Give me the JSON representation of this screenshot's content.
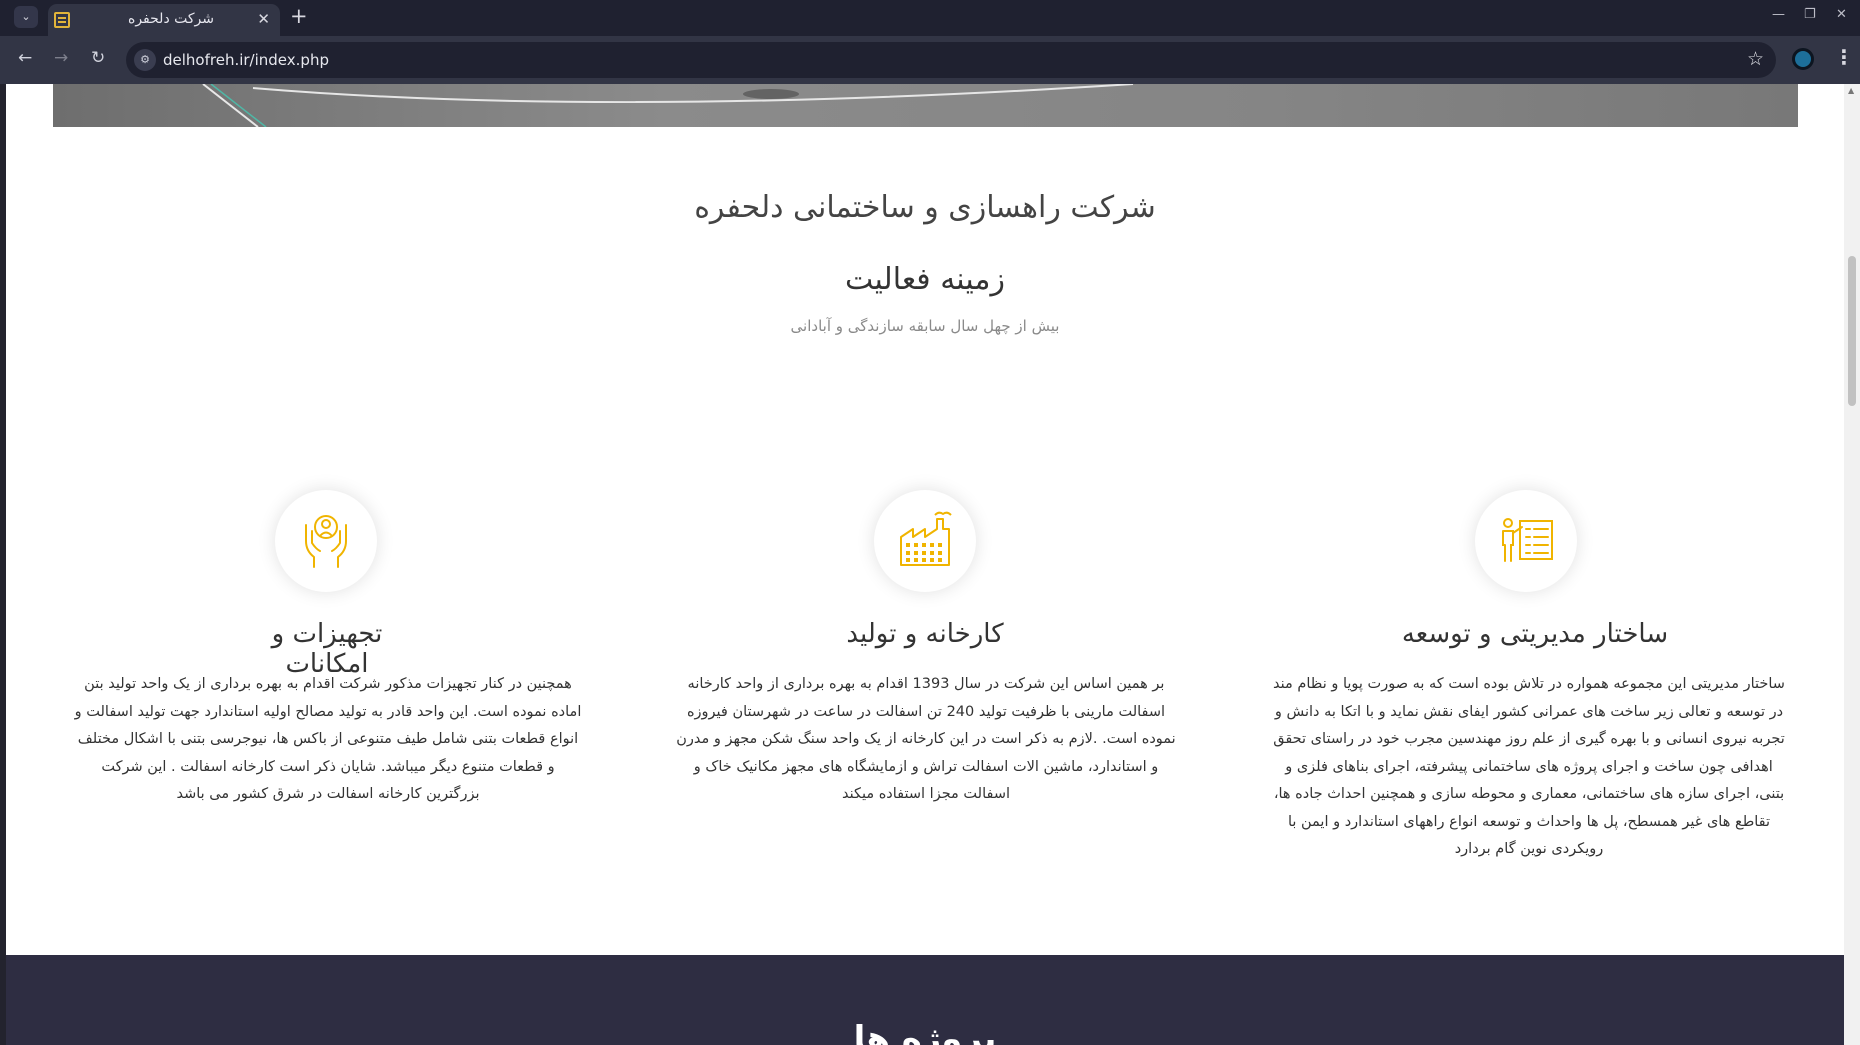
{
  "browser": {
    "tab_title": "شرکت دلحفره",
    "url": "delhofreh.ir/index.php",
    "tab_close_glyph": "✕",
    "new_tab_glyph": "+",
    "minimize_glyph": "—",
    "restore_glyph": "❐",
    "close_glyph": "✕",
    "back_glyph": "←",
    "forward_glyph": "→",
    "reload_glyph": "↻",
    "star_glyph": "☆",
    "menu_glyph": "⋮",
    "tab_list_glyph": "⌄",
    "site_info_glyph": "⚙"
  },
  "page": {
    "company_title": "شرکت راهسازی و ساختمانی دلحفره",
    "section_title": "زمینه فعالیت",
    "section_subtitle": "بیش از چهل سال سابقه سازندگی و آبادانی",
    "accent_color": "#f0b400",
    "footer_heading": "پروژه ها"
  },
  "features": [
    {
      "icon": "organization-chart-icon",
      "title": "ساختار مدیریتی و توسعه",
      "text": "ساختار مدیریتی این مجموعه همواره در تلاش بوده است که به صورت پویا و نظام مند در توسعه و تعالی زیر ساخت های عمرانی کشور ایفای نقش نماید و با اتکا به دانش و تجربه نیروی انسانی و با بهره گیری از علم روز مهندسین مجرب خود در راستای تحقق اهدافی چون ساخت و اجرای پروژه های ساختمانی پیشرفته، اجرای بناهای فلزی و بتنی، اجرای سازه های ساختمانی، معماری و محوطه سازی و همچنین احداث جاده ها، تقاطع های غیر همسطح، پل ها واحداث و توسعه انواع راههای استاندارد و ایمن با رویکردی نوین گام بردارد"
    },
    {
      "icon": "factory-icon",
      "title": "کارخانه و تولید",
      "text": "بر همین اساس این شرکت در سال 1393 اقدام به بهره برداری از واحد کارخانه اسفالت مارینی با ظرفیت تولید 240 تن اسفالت در ساعت در شهرستان فیروزه نموده است. .لازم به ذکر است در این کارخانه از یک واحد سنگ شکن مجهز و مدرن و استاندارد، ماشین الات اسفالت تراش و ازمایشگاه های مجهز مکانیک خاک و اسفالت مجزا استفاده میکند"
    },
    {
      "icon": "hands-worker-icon",
      "title": "تجهیزات و امکانات",
      "text": "همچنین در کنار تجهیزات مذکور شرکت اقدام به بهره برداری از یک واحد تولید بتن اماده نموده است. این واحد قادر به تولید مصالح اولیه استاندارد جهت تولید اسفالت و انواع قطعات بتنی شامل طیف متنوعی از باکس ها، نیوجرسی بتنی با اشکال مختلف و قطعات متنوع دیگر میباشد. شایان ذکر است کارخانه اسفالت . این شرکت بزرگترین کارخانه اسفالت در شرق کشور می باشد"
    }
  ]
}
